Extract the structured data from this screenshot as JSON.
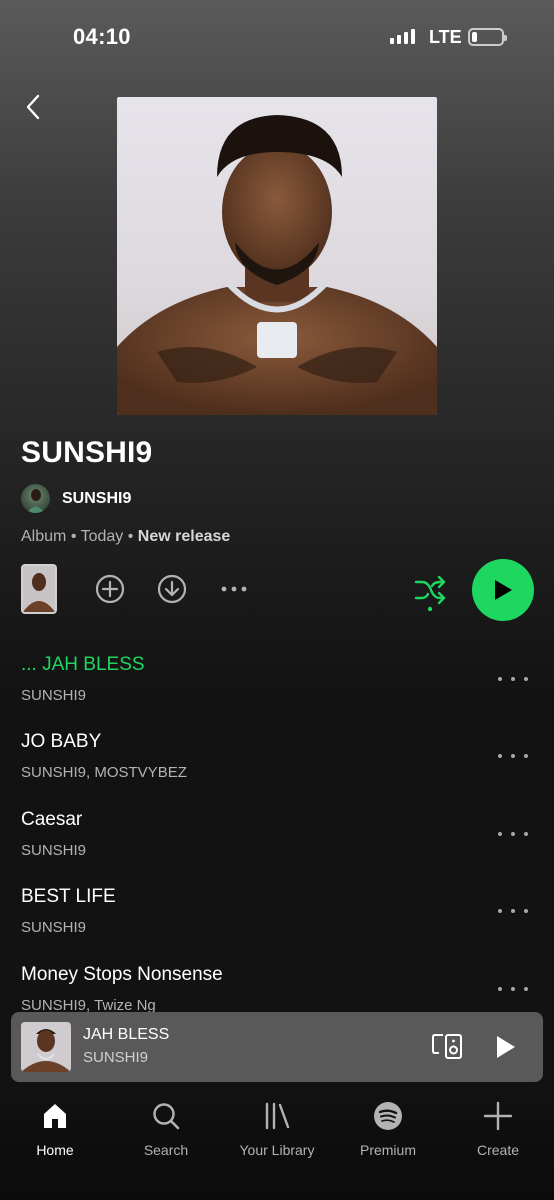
{
  "status_bar": {
    "time": "04:10",
    "network": "LTE"
  },
  "album": {
    "title": "SUNSHI9",
    "artist": "SUNSHI9",
    "type": "Album",
    "date": "Today",
    "release_badge": "New release"
  },
  "actions": {
    "add_icon": "plus-circle-icon",
    "download_icon": "download-circle-icon",
    "more_icon": "more-horizontal-icon",
    "shuffle_icon": "shuffle-icon",
    "play_icon": "play-icon"
  },
  "tracks": [
    {
      "title": "... JAH BLESS",
      "artist": "SUNSHI9",
      "playing": true
    },
    {
      "title": "JO BABY",
      "artist": "SUNSHI9, MOSTVYBEZ",
      "playing": false
    },
    {
      "title": "Caesar",
      "artist": "SUNSHI9",
      "playing": false
    },
    {
      "title": "BEST LIFE",
      "artist": "SUNSHI9",
      "playing": false
    },
    {
      "title": "Money Stops Nonsense",
      "artist": "SUNSHI9, Twize Ng",
      "playing": false
    }
  ],
  "now_playing": {
    "title": "JAH BLESS",
    "artist": "SUNSHI9"
  },
  "nav": [
    {
      "label": "Home",
      "icon": "home-icon",
      "active": true
    },
    {
      "label": "Search",
      "icon": "search-icon",
      "active": false
    },
    {
      "label": "Your Library",
      "icon": "library-icon",
      "active": false
    },
    {
      "label": "Premium",
      "icon": "spotify-icon",
      "active": false
    },
    {
      "label": "Create",
      "icon": "plus-icon",
      "active": false
    }
  ],
  "colors": {
    "accent": "#1ed760",
    "background": "#121212",
    "mini_player": "#595959"
  }
}
